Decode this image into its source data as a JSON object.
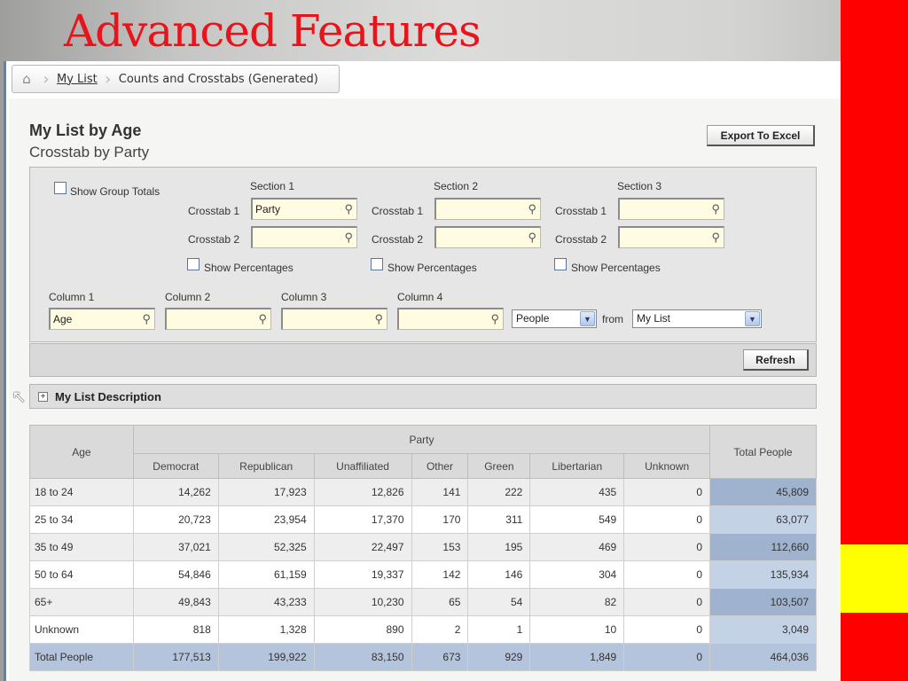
{
  "slide": {
    "title": "Advanced Features",
    "colors": {
      "title": "#e8141b",
      "red_bar": "#fe0000",
      "yellow_bar": "#ffff01"
    }
  },
  "breadcrumb": {
    "home_icon": "home-icon",
    "items": [
      "My List",
      "Counts and Crosstabs (Generated)"
    ]
  },
  "header": {
    "title": "My List by Age",
    "subtitle": "Crosstab by Party",
    "export_label": "Export To Excel"
  },
  "options": {
    "show_group_totals": "Show Group Totals",
    "sections": [
      {
        "title": "Section 1",
        "crosstab1_label": "Crosstab 1",
        "crosstab1_value": "Party",
        "crosstab2_label": "Crosstab 2",
        "crosstab2_value": "",
        "show_percentages": "Show Percentages"
      },
      {
        "title": "Section 2",
        "crosstab1_label": "Crosstab 1",
        "crosstab1_value": "",
        "crosstab2_label": "Crosstab 2",
        "crosstab2_value": "",
        "show_percentages": "Show Percentages"
      },
      {
        "title": "Section 3",
        "crosstab1_label": "Crosstab 1",
        "crosstab1_value": "",
        "crosstab2_label": "Crosstab 2",
        "crosstab2_value": "",
        "show_percentages": "Show Percentages"
      }
    ],
    "columns": [
      {
        "label": "Column 1",
        "value": "Age"
      },
      {
        "label": "Column 2",
        "value": ""
      },
      {
        "label": "Column 3",
        "value": ""
      },
      {
        "label": "Column 4",
        "value": ""
      }
    ],
    "count_select": "People",
    "from_label": "from",
    "list_select": "My List",
    "refresh_label": "Refresh"
  },
  "description": {
    "label": "My List Description"
  },
  "table": {
    "row_header": "Age",
    "group_header": "Party",
    "columns": [
      "Democrat",
      "Republican",
      "Unaffiliated",
      "Other",
      "Green",
      "Libertarian",
      "Unknown"
    ],
    "total_header": "Total People",
    "rows": [
      {
        "label": "18 to 24",
        "values": [
          "14,262",
          "17,923",
          "12,826",
          "141",
          "222",
          "435",
          "0"
        ],
        "total": "45,809"
      },
      {
        "label": "25 to 34",
        "values": [
          "20,723",
          "23,954",
          "17,370",
          "170",
          "311",
          "549",
          "0"
        ],
        "total": "63,077"
      },
      {
        "label": "35 to 49",
        "values": [
          "37,021",
          "52,325",
          "22,497",
          "153",
          "195",
          "469",
          "0"
        ],
        "total": "112,660"
      },
      {
        "label": "50 to 64",
        "values": [
          "54,846",
          "61,159",
          "19,337",
          "142",
          "146",
          "304",
          "0"
        ],
        "total": "135,934"
      },
      {
        "label": "65+",
        "values": [
          "49,843",
          "43,233",
          "10,230",
          "65",
          "54",
          "82",
          "0"
        ],
        "total": "103,507"
      },
      {
        "label": "Unknown",
        "values": [
          "818",
          "1,328",
          "890",
          "2",
          "1",
          "10",
          "0"
        ],
        "total": "3,049"
      }
    ],
    "totals": {
      "label": "Total People",
      "values": [
        "177,513",
        "199,922",
        "83,150",
        "673",
        "929",
        "1,849",
        "0"
      ],
      "total": "464,036"
    }
  }
}
